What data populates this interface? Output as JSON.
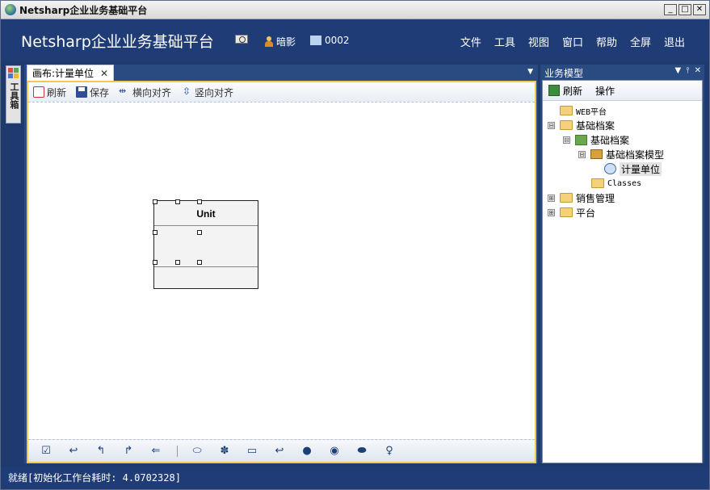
{
  "window": {
    "title": "Netsharp企业业务基础平台",
    "buttons": {
      "minimize": "_",
      "maximize": "□",
      "close": "✕"
    }
  },
  "header": {
    "brand": "Netsharp企业业务基础平台",
    "user": "暗影",
    "workstation": "0002",
    "menu": [
      "文件",
      "工具",
      "视图",
      "窗口",
      "帮助",
      "全屏",
      "退出"
    ]
  },
  "left_strip": {
    "label": "工具箱"
  },
  "document": {
    "tab_label": "画布:计量单位",
    "tab_close": "✕",
    "toolbar": {
      "refresh": "刷新",
      "save": "保存",
      "h_align": "横向对齐",
      "v_align": "竖向对齐"
    },
    "entity": {
      "name": "Unit"
    }
  },
  "right_panel": {
    "title": "业务模型",
    "toolbar": {
      "refresh": "刷新",
      "actions": "操作"
    },
    "tree": [
      {
        "label": "WEB平台",
        "expander": ""
      },
      {
        "label": "基础档案",
        "expander": "⊟"
      },
      {
        "label": "基础档案",
        "expander": "⊟"
      },
      {
        "label": "基础档案模型",
        "expander": "⊟"
      },
      {
        "label": "计量单位",
        "expander": ""
      },
      {
        "label": "Classes",
        "expander": ""
      },
      {
        "label": "销售管理",
        "expander": "⊞"
      },
      {
        "label": "平台",
        "expander": "⊞"
      }
    ]
  },
  "status": {
    "text": "就绪[初始化工作台耗时: 4.0702328]"
  },
  "colors": {
    "header_bg": "#1f3c77",
    "panel_accent": "#f3c84a",
    "folder": "#f3d27a"
  }
}
